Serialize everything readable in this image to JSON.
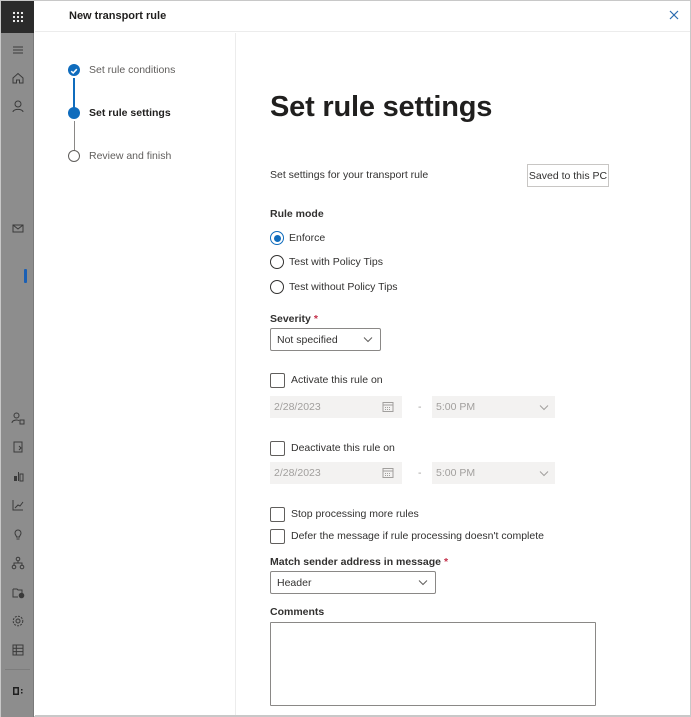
{
  "panel": {
    "title": "New transport rule",
    "close_label": "Close"
  },
  "nav_rail": {
    "items": [
      {
        "name": "app-launcher",
        "icon": "waffle-icon"
      },
      {
        "name": "collapse-nav",
        "icon": "hamburger-icon"
      },
      {
        "name": "home",
        "icon": "home-icon"
      },
      {
        "name": "recipients",
        "icon": "person-icon"
      },
      {
        "name": "mail-flow",
        "icon": "mail-icon",
        "active": true
      },
      {
        "name": "roles",
        "icon": "person-lock-icon"
      },
      {
        "name": "migration",
        "icon": "document-arrow-icon"
      },
      {
        "name": "mobile",
        "icon": "devices-icon"
      },
      {
        "name": "reports",
        "icon": "chart-line-icon"
      },
      {
        "name": "insights",
        "icon": "lightbulb-icon"
      },
      {
        "name": "organization",
        "icon": "org-chart-icon"
      },
      {
        "name": "public-folders",
        "icon": "folder-globe-icon"
      },
      {
        "name": "settings",
        "icon": "gear-icon"
      },
      {
        "name": "other-features",
        "icon": "table-icon"
      },
      {
        "name": "exchange-classic",
        "icon": "exchange-logo-icon"
      }
    ]
  },
  "steps": [
    {
      "label": "Set rule conditions",
      "state": "completed"
    },
    {
      "label": "Set rule settings",
      "state": "current"
    },
    {
      "label": "Review and finish",
      "state": "pending"
    }
  ],
  "main": {
    "title": "Set rule settings",
    "description": "Set settings for your transport rule",
    "saved_badge": "Saved to this PC",
    "rule_mode": {
      "label": "Rule mode",
      "options": [
        {
          "label": "Enforce",
          "selected": true
        },
        {
          "label": "Test with Policy Tips",
          "selected": false
        },
        {
          "label": "Test without Policy Tips",
          "selected": false
        }
      ]
    },
    "severity": {
      "label": "Severity",
      "required_mark": "*",
      "value": "Not specified"
    },
    "activate": {
      "label": "Activate this rule on",
      "checked": false,
      "date": "2/28/2023",
      "separator": "-",
      "time": "5:00 PM"
    },
    "deactivate": {
      "label": "Deactivate this rule on",
      "checked": false,
      "date": "2/28/2023",
      "separator": "-",
      "time": "5:00 PM"
    },
    "stop_processing": {
      "label": "Stop processing more rules",
      "checked": false
    },
    "defer_message": {
      "label": "Defer the message if rule processing doesn't complete",
      "checked": false
    },
    "match_sender": {
      "label": "Match sender address in message",
      "required_mark": "*",
      "value": "Header"
    },
    "comments": {
      "label": "Comments",
      "value": ""
    }
  },
  "colors": {
    "accent": "#0f6cbd",
    "rail_bg": "#8d8d8d",
    "waffle_bg": "#2b2b2b",
    "required": "#c4314b",
    "disabled_bg": "#f3f2f1"
  }
}
